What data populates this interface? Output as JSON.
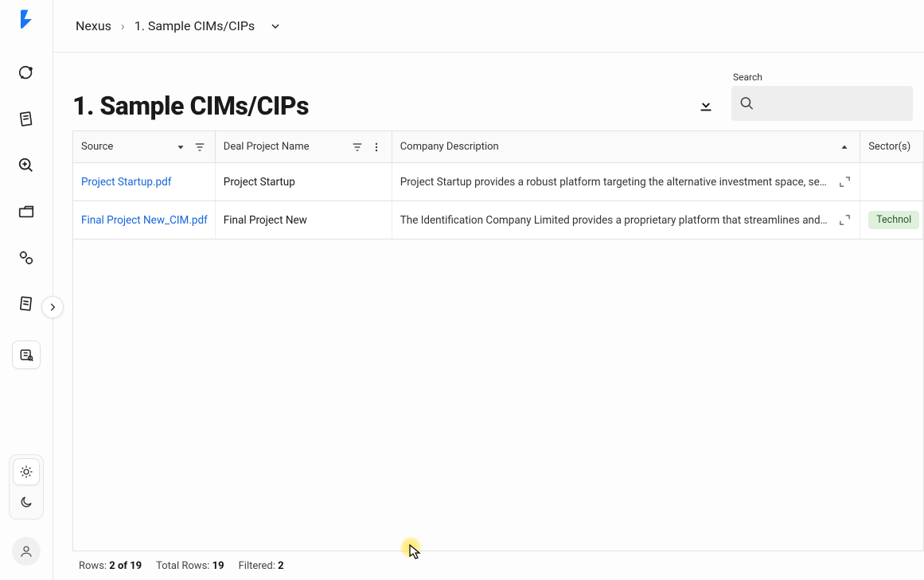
{
  "breadcrumb": {
    "root": "Nexus",
    "current": "1. Sample CIMs/CIPs"
  },
  "page": {
    "title": "1. Sample CIMs/CIPs"
  },
  "search": {
    "label": "Search",
    "placeholder": ""
  },
  "columns": {
    "source": "Source",
    "deal": "Deal Project Name",
    "desc": "Company Description",
    "sector": "Sector(s)"
  },
  "rows": [
    {
      "source": "Project Startup.pdf",
      "deal": "Project Startup",
      "desc": "Project Startup provides a robust platform targeting the alternative investment space, serving a divers...",
      "sector": ""
    },
    {
      "source": "Final Project New_CIM.pdf",
      "deal": "Final Project New",
      "desc": "The Identification Company Limited provides a proprietary platform that streamlines and standardize...",
      "sector": "Technol"
    }
  ],
  "footer": {
    "rows_label": "Rows:",
    "rows_value": "2 of 19",
    "total_label": "Total Rows:",
    "total_value": "19",
    "filtered_label": "Filtered:",
    "filtered_value": "2"
  },
  "icons": {
    "rail": [
      "chat",
      "note",
      "zoom",
      "folder",
      "gears",
      "note2",
      "library"
    ],
    "theme": {
      "light": "sun",
      "dark": "moon"
    }
  }
}
